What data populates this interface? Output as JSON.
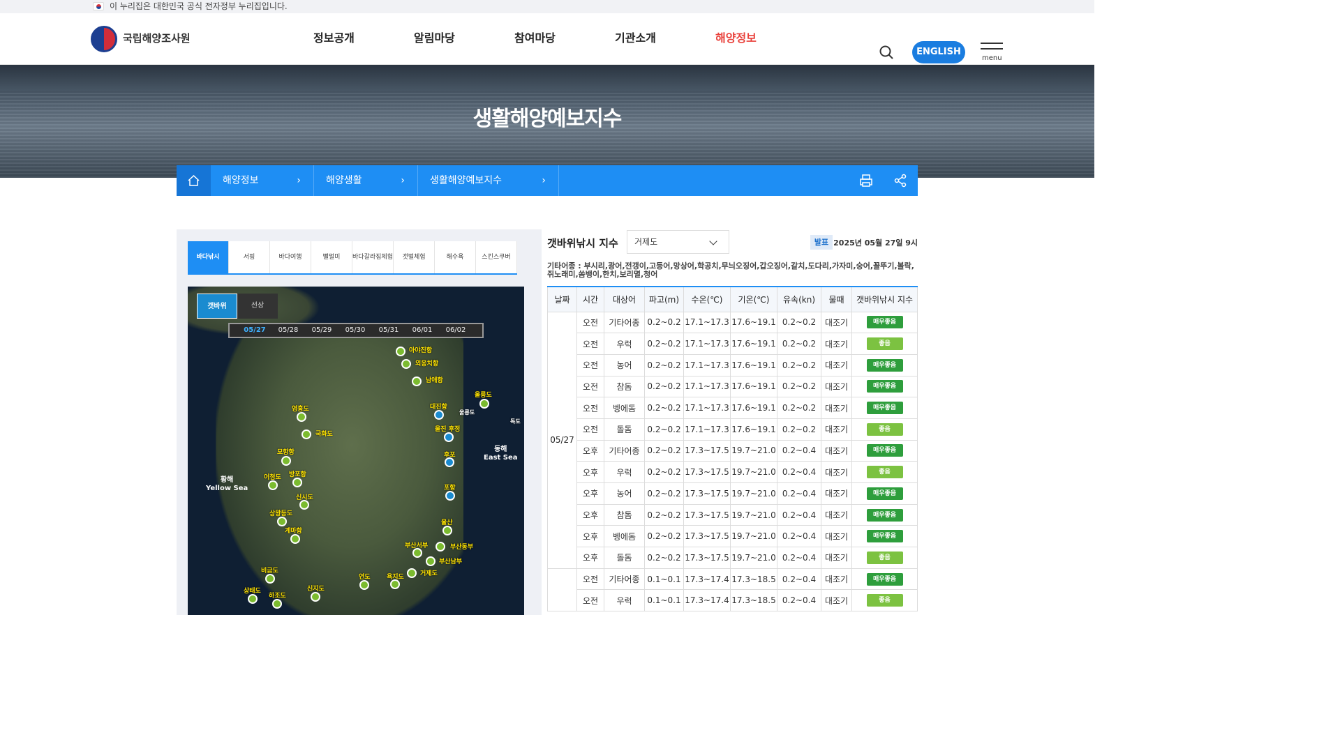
{
  "gov_notice": "이 누리집은 대한민국 공식 전자정부 누리집입니다.",
  "org_name": "국립해양조사원",
  "nav": [
    "정보공개",
    "알림마당",
    "참여마당",
    "기관소개",
    "해양정보"
  ],
  "english_label": "ENGLISH",
  "menu_label": "menu",
  "hero_title": "생활해양예보지수",
  "breadcrumb": [
    "해양정보",
    "해양생활",
    "생활해양예보지수"
  ],
  "tabs": [
    "바다낚시",
    "서핑",
    "바다여행",
    "뻘멀미",
    "바다갈라짐체험",
    "갯벌체험",
    "해수욕",
    "스킨스쿠버"
  ],
  "map_tabs": [
    "갯바위",
    "선상"
  ],
  "map_dates": [
    "05/27",
    "05/28",
    "05/29",
    "05/30",
    "05/31",
    "06/01",
    "06/02"
  ],
  "map_places": [
    "아야진항",
    "외옹치항",
    "남애항",
    "울릉도",
    "대진항",
    "울릉도",
    "독도",
    "울진 후정",
    "후포",
    "포항",
    "울산",
    "부산동부",
    "부산서부",
    "부산남부",
    "거제도",
    "욕지도",
    "연도",
    "신지도",
    "하조도",
    "상태도",
    "비금도",
    "계마항",
    "상왕등도",
    "신시도",
    "어청도",
    "방포항",
    "모항항",
    "국화도",
    "영흥도"
  ],
  "sea_labels": {
    "west_ko": "황해",
    "west_en": "Yellow Sea",
    "east_ko": "동해",
    "east_en": "East Sea"
  },
  "index_title": "갯바위낚시 지수",
  "region": "거제도",
  "pub_label": "발표",
  "pub_date": "2025년 05월 27일 9시",
  "fish_list": "기타어종 : 부시리,광어,전갱이,고등어,망상어,학공치,무늬오징어,갑오징어,갈치,도다리,가자미,숭어,꼴뚜기,볼락,쥐노래미,쏨뱅이,한치,보리멸,청어",
  "columns": [
    "날짜",
    "시간",
    "대상어",
    "파고(m)",
    "수온(℃)",
    "기온(℃)",
    "유속(kn)",
    "물때",
    "갯바위낚시 지수"
  ],
  "date_group": "05/27",
  "rows": [
    [
      "오전",
      "기타어종",
      "0.2~0.2",
      "17.1~17.3",
      "17.6~19.1",
      "0.2~0.2",
      "대조기",
      "매우좋음"
    ],
    [
      "오전",
      "우럭",
      "0.2~0.2",
      "17.1~17.3",
      "17.6~19.1",
      "0.2~0.2",
      "대조기",
      "좋음"
    ],
    [
      "오전",
      "농어",
      "0.2~0.2",
      "17.1~17.3",
      "17.6~19.1",
      "0.2~0.2",
      "대조기",
      "매우좋음"
    ],
    [
      "오전",
      "참돔",
      "0.2~0.2",
      "17.1~17.3",
      "17.6~19.1",
      "0.2~0.2",
      "대조기",
      "매우좋음"
    ],
    [
      "오전",
      "벵에돔",
      "0.2~0.2",
      "17.1~17.3",
      "17.6~19.1",
      "0.2~0.2",
      "대조기",
      "매우좋음"
    ],
    [
      "오전",
      "돌돔",
      "0.2~0.2",
      "17.1~17.3",
      "17.6~19.1",
      "0.2~0.2",
      "대조기",
      "좋음"
    ],
    [
      "오후",
      "기타어종",
      "0.2~0.2",
      "17.3~17.5",
      "19.7~21.0",
      "0.2~0.4",
      "대조기",
      "매우좋음"
    ],
    [
      "오후",
      "우럭",
      "0.2~0.2",
      "17.3~17.5",
      "19.7~21.0",
      "0.2~0.4",
      "대조기",
      "좋음"
    ],
    [
      "오후",
      "농어",
      "0.2~0.2",
      "17.3~17.5",
      "19.7~21.0",
      "0.2~0.4",
      "대조기",
      "매우좋음"
    ],
    [
      "오후",
      "참돔",
      "0.2~0.2",
      "17.3~17.5",
      "19.7~21.0",
      "0.2~0.4",
      "대조기",
      "매우좋음"
    ],
    [
      "오후",
      "벵에돔",
      "0.2~0.2",
      "17.3~17.5",
      "19.7~21.0",
      "0.2~0.4",
      "대조기",
      "매우좋음"
    ],
    [
      "오후",
      "돌돔",
      "0.2~0.2",
      "17.3~17.5",
      "19.7~21.0",
      "0.2~0.4",
      "대조기",
      "좋음"
    ],
    [
      "오전",
      "기타어종",
      "0.1~0.1",
      "17.3~17.4",
      "17.3~18.5",
      "0.2~0.4",
      "대조기",
      "매우좋음"
    ],
    [
      "오전",
      "우럭",
      "0.1~0.1",
      "17.3~17.4",
      "17.3~18.5",
      "0.2~0.4",
      "대조기",
      "좋음"
    ]
  ],
  "colors": {
    "accent": "#1e8ef4",
    "active_nav": "#e9413b",
    "very_good": "#2e9e3c",
    "good": "#7cc241"
  }
}
